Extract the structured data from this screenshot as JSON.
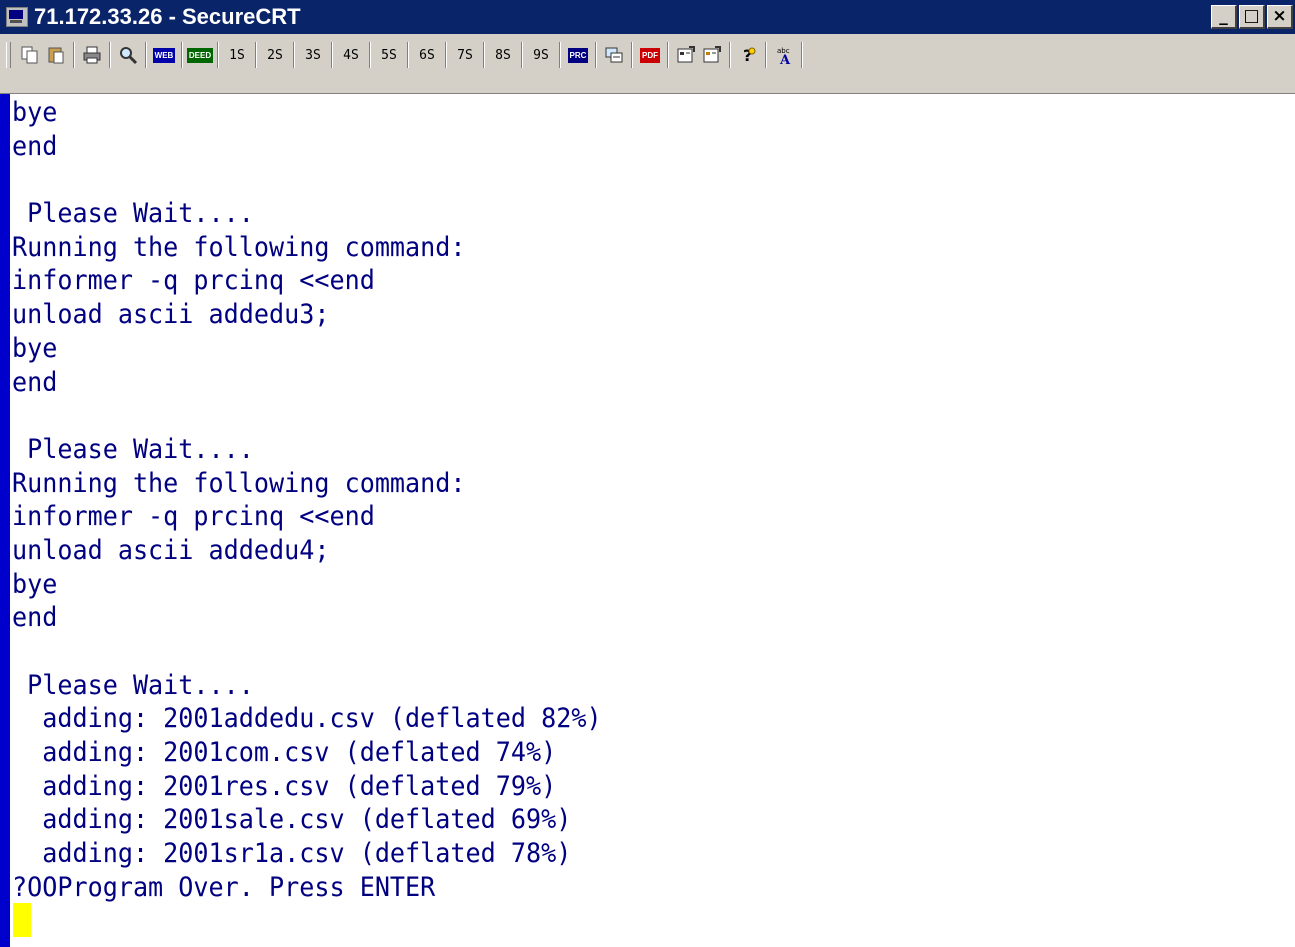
{
  "window": {
    "title": "71.172.33.26 - SecureCRT",
    "controls": [
      "_",
      "□",
      "×"
    ]
  },
  "toolbar": {
    "icons": [
      "copy-icon",
      "paste-icon",
      "print-icon",
      "find-icon"
    ],
    "tag_web": "WEB",
    "tag_deed": "DEED",
    "session_buttons": [
      "1S",
      "2S",
      "3S",
      "4S",
      "5S",
      "6S",
      "7S",
      "8S",
      "9S"
    ],
    "tag_prc": "PRC",
    "tag_pdf": "PDF",
    "colors": {
      "web": "#0000aa",
      "deed": "#006600",
      "prc": "#000080",
      "pdf": "#cc0000"
    }
  },
  "terminal": {
    "lines": [
      "bye",
      "end",
      "",
      " Please Wait....",
      "Running the following command:",
      "informer -q prcinq <<end",
      "unload ascii addedu3;",
      "bye",
      "end",
      "",
      " Please Wait....",
      "Running the following command:",
      "informer -q prcinq <<end",
      "unload ascii addedu4;",
      "bye",
      "end",
      "",
      " Please Wait....",
      "  adding: 2001addedu.csv (deflated 82%)",
      "  adding: 2001com.csv (deflated 74%)",
      "  adding: 2001res.csv (deflated 79%)",
      "  adding: 2001sale.csv (deflated 69%)",
      "  adding: 2001sr1a.csv (deflated 78%)",
      "?OOProgram Over. Press ENTER"
    ],
    "text_color": "#000080",
    "cursor_color": "#ffff00"
  }
}
